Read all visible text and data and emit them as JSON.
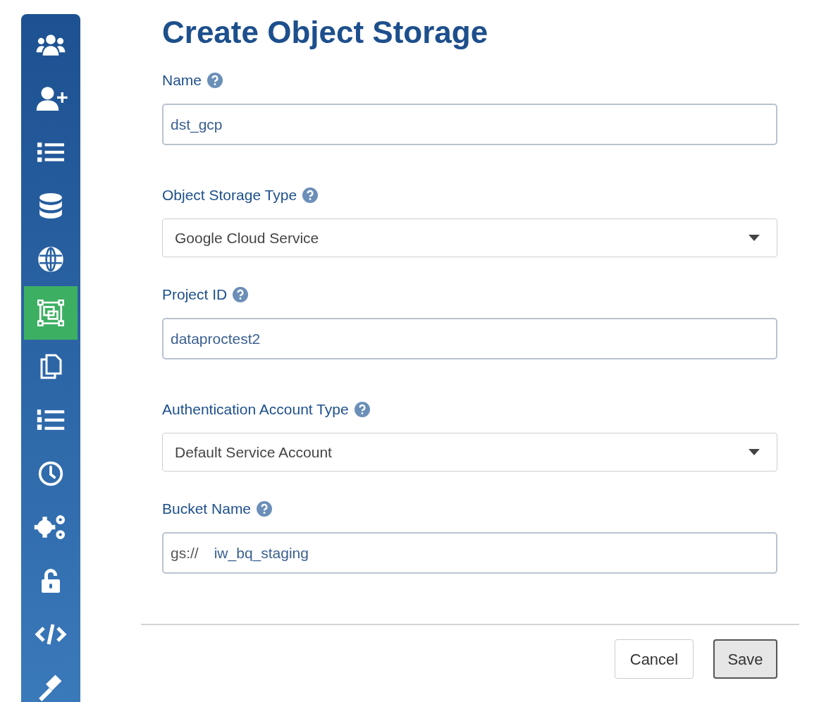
{
  "sidebar": {
    "items": [
      {
        "selected": false
      },
      {
        "selected": false
      },
      {
        "selected": false
      },
      {
        "selected": false
      },
      {
        "selected": false
      },
      {
        "selected": true
      },
      {
        "selected": false
      },
      {
        "selected": false
      },
      {
        "selected": false
      },
      {
        "selected": false
      },
      {
        "selected": false
      },
      {
        "selected": false
      },
      {
        "selected": false
      }
    ]
  },
  "title": "Create Object Storage",
  "fields": [
    {
      "kind": "text",
      "label": "Name",
      "value": "dst_gcp"
    },
    {
      "kind": "select",
      "label": "Object Storage Type",
      "value": "Google Cloud Service"
    },
    {
      "kind": "text",
      "label": "Project ID",
      "value": "dataproctest2"
    },
    {
      "kind": "select",
      "label": "Authentication Account Type",
      "value": "Default Service Account"
    },
    {
      "kind": "prefixed",
      "label": "Bucket Name",
      "prefix": "gs://",
      "value": "iw_bq_staging"
    }
  ],
  "buttons": [
    {
      "label": "Cancel",
      "kind": "default"
    },
    {
      "label": "Save",
      "kind": "primary"
    }
  ]
}
